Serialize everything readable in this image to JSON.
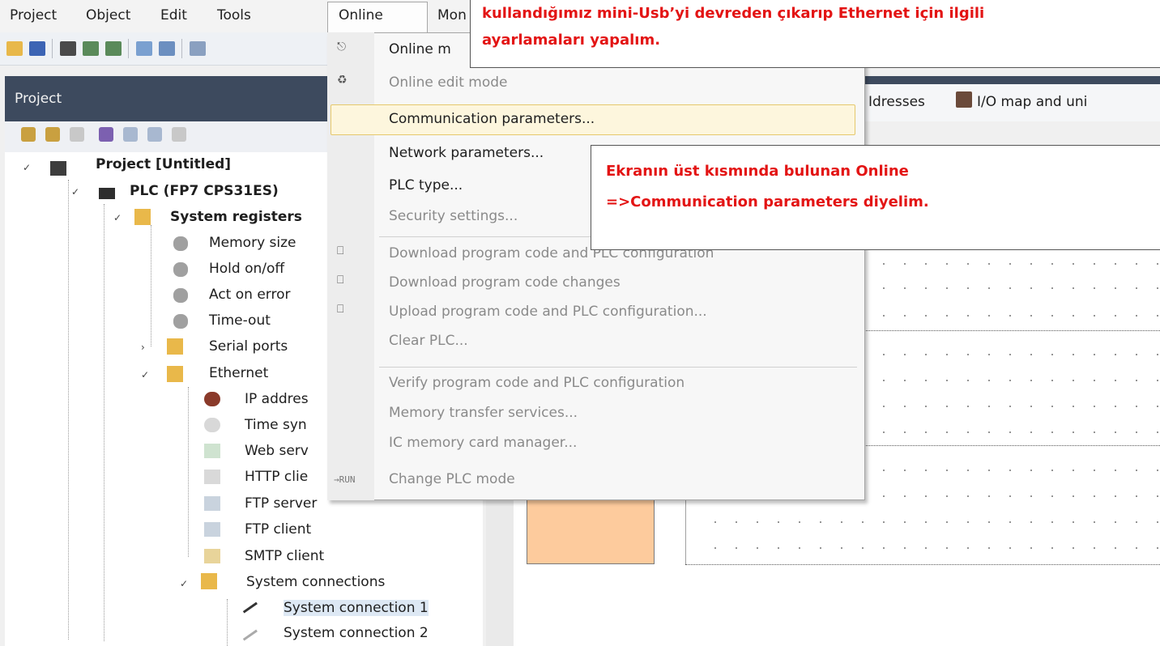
{
  "menubar": {
    "items": [
      "Project",
      "Object",
      "Edit",
      "Tools",
      "Online",
      "Mon"
    ]
  },
  "project_panel": {
    "title": "Project",
    "tree": [
      {
        "label": "Project [Untitled]",
        "bold": true
      },
      {
        "label": "PLC (FP7 CPS31ES)",
        "bold": true
      },
      {
        "label": "System registers",
        "bold": true
      },
      {
        "label": "Memory size"
      },
      {
        "label": "Hold on/off"
      },
      {
        "label": "Act on error"
      },
      {
        "label": "Time-out"
      },
      {
        "label": "Serial ports"
      },
      {
        "label": "Ethernet"
      },
      {
        "label": "IP addres"
      },
      {
        "label": "Time syn"
      },
      {
        "label": "Web serv"
      },
      {
        "label": "HTTP clie"
      },
      {
        "label": "FTP server"
      },
      {
        "label": "FTP client"
      },
      {
        "label": "SMTP client"
      },
      {
        "label": "System connections"
      },
      {
        "label": "System connection 1"
      },
      {
        "label": "System connection 2"
      }
    ]
  },
  "right_tabs": {
    "addresses_partial": "Idresses",
    "io_map": "I/O map and uni"
  },
  "online_menu": {
    "items": [
      {
        "label": "Online m",
        "enabled": true
      },
      {
        "label": "Online edit mode",
        "enabled": false
      },
      {
        "label": "Communication parameters...",
        "enabled": true,
        "highlighted": true
      },
      {
        "label": "Network parameters...",
        "enabled": true
      },
      {
        "label": "PLC type...",
        "enabled": true
      },
      {
        "label": "Security settings...",
        "enabled": false
      },
      {
        "label": "Download program code and PLC configuration",
        "enabled": false
      },
      {
        "label": "Download program code changes",
        "enabled": false
      },
      {
        "label": "Upload program code and PLC configuration...",
        "enabled": false
      },
      {
        "label": "Clear PLC...",
        "enabled": false
      },
      {
        "label": "Verify program code and PLC configuration",
        "enabled": false
      },
      {
        "label": "Memory transfer services...",
        "enabled": false
      },
      {
        "label": "IC memory card manager...",
        "enabled": false
      },
      {
        "label": "Change PLC mode",
        "enabled": false
      }
    ],
    "run_icon_text": "→RUN"
  },
  "callouts": {
    "top_line1": "kullandığımız mini-Usb’yi devreden çıkarıp Ethernet için ilgili",
    "top_line2": "ayarlamaları yapalım.",
    "mid_line1": "Ekranın üst kısmında bulunan Online",
    "mid_line2": "=>Communication parameters diyelim."
  },
  "colors": {
    "callout_text": "#e31414",
    "panel_header": "#3d4a5e",
    "menu_highlight": "#fdf6dd",
    "orange_block": "#fdcb9d"
  }
}
